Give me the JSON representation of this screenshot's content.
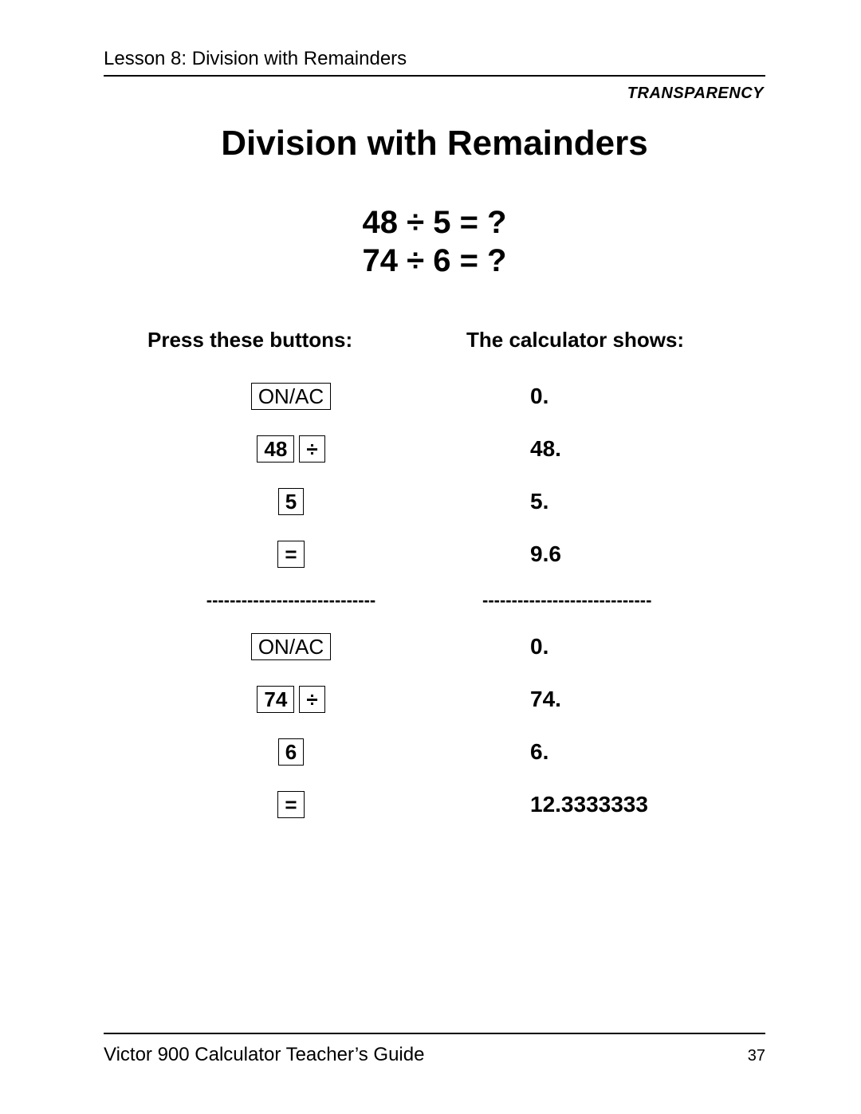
{
  "lesson_header": "Lesson 8:  Division with Remainders",
  "transparency_label": "TRANSPARENCY",
  "page_title": "Division with Remainders",
  "problem1": "48 ÷ 5 = ?",
  "problem2": "74 ÷ 6 = ?",
  "col_left_header": "Press these buttons:",
  "col_right_header": "The calculator shows:",
  "rows1": {
    "press": [
      [
        "ON/AC"
      ],
      [
        "48",
        "÷"
      ],
      [
        "5"
      ],
      [
        "="
      ]
    ],
    "shows": [
      "0.",
      "48.",
      "5.",
      "9.6"
    ]
  },
  "separator": "-----------------------------",
  "rows2": {
    "press": [
      [
        "ON/AC"
      ],
      [
        "74",
        "÷"
      ],
      [
        "6"
      ],
      [
        "="
      ]
    ],
    "shows": [
      "0.",
      "74.",
      "6.",
      "12.3333333"
    ]
  },
  "footer_title": "Victor 900 Calculator Teacher’s Guide",
  "footer_page": "37"
}
